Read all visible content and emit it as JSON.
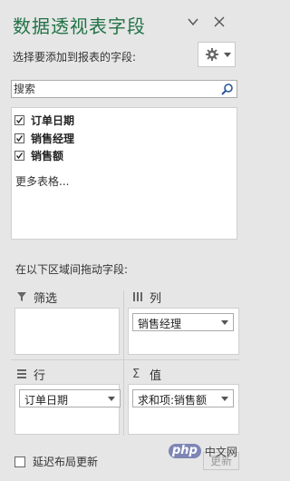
{
  "header": {
    "title": "数据透视表字段",
    "choose_label": "选择要添加到报表的字段:"
  },
  "search": {
    "placeholder": "搜索"
  },
  "fields": [
    {
      "label": "订单日期",
      "checked": true
    },
    {
      "label": "销售经理",
      "checked": true
    },
    {
      "label": "销售额",
      "checked": true
    }
  ],
  "more_tables": "更多表格...",
  "drag_hint": "在以下区域间拖动字段:",
  "areas": {
    "filters": {
      "label": "筛选",
      "items": []
    },
    "columns": {
      "label": "列",
      "items": [
        "销售经理"
      ]
    },
    "rows": {
      "label": "行",
      "items": [
        "订单日期"
      ]
    },
    "values": {
      "label": "值",
      "items": [
        "求和项:销售额"
      ]
    }
  },
  "footer": {
    "defer_label": "延迟布局更新",
    "update_label": "更新"
  },
  "watermark": {
    "brand": "php",
    "text": "中文网"
  },
  "colors": {
    "accent": "#217346",
    "pane_bg": "#e6e6e6"
  }
}
